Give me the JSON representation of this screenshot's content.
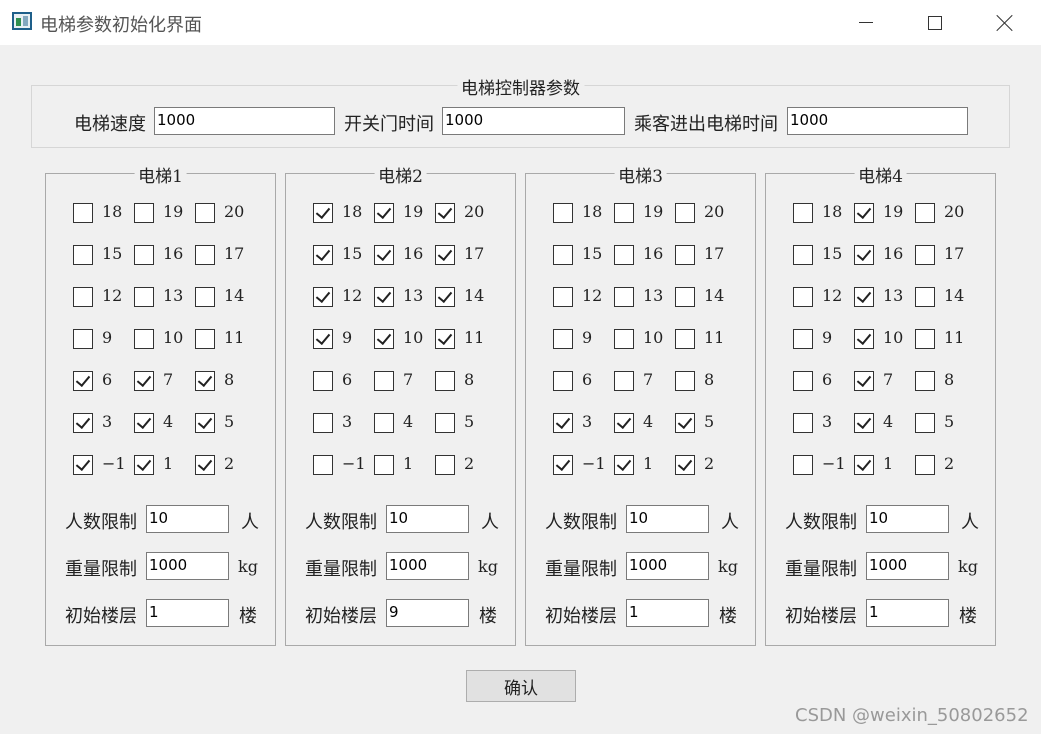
{
  "window": {
    "title": "电梯参数初始化界面"
  },
  "controller": {
    "title": "电梯控制器参数",
    "speed_label": "电梯速度",
    "speed_value": "1000",
    "door_time_label": "开关门时间",
    "door_time_value": "1000",
    "passenger_time_label": "乘客进出电梯时间",
    "passenger_time_value": "1000"
  },
  "floor_rows": [
    [
      "18",
      "19",
      "20"
    ],
    [
      "15",
      "16",
      "17"
    ],
    [
      "12",
      "13",
      "14"
    ],
    [
      "9",
      "10",
      "11"
    ],
    [
      "6",
      "7",
      "8"
    ],
    [
      "3",
      "4",
      "5"
    ],
    [
      "−1",
      "1",
      "2"
    ]
  ],
  "labels": {
    "people_limit": "人数限制",
    "people_unit": "人",
    "weight_limit": "重量限制",
    "weight_unit": "kg",
    "initial_floor": "初始楼层",
    "floor_unit": "楼"
  },
  "elevators": [
    {
      "title": "电梯1",
      "checked": [
        [
          false,
          false,
          false
        ],
        [
          false,
          false,
          false
        ],
        [
          false,
          false,
          false
        ],
        [
          false,
          false,
          false
        ],
        [
          true,
          true,
          true
        ],
        [
          true,
          true,
          true
        ],
        [
          true,
          true,
          true
        ]
      ],
      "people_limit": "10",
      "weight_limit": "1000",
      "initial_floor": "1"
    },
    {
      "title": "电梯2",
      "checked": [
        [
          true,
          true,
          true
        ],
        [
          true,
          true,
          true
        ],
        [
          true,
          true,
          true
        ],
        [
          true,
          true,
          true
        ],
        [
          false,
          false,
          false
        ],
        [
          false,
          false,
          false
        ],
        [
          false,
          false,
          false
        ]
      ],
      "people_limit": "10",
      "weight_limit": "1000",
      "initial_floor": "9"
    },
    {
      "title": "电梯3",
      "checked": [
        [
          false,
          false,
          false
        ],
        [
          false,
          false,
          false
        ],
        [
          false,
          false,
          false
        ],
        [
          false,
          false,
          false
        ],
        [
          false,
          false,
          false
        ],
        [
          true,
          true,
          true
        ],
        [
          true,
          true,
          true
        ]
      ],
      "people_limit": "10",
      "weight_limit": "1000",
      "initial_floor": "1"
    },
    {
      "title": "电梯4",
      "checked": [
        [
          false,
          true,
          false
        ],
        [
          false,
          true,
          false
        ],
        [
          false,
          true,
          false
        ],
        [
          false,
          true,
          false
        ],
        [
          false,
          true,
          false
        ],
        [
          false,
          true,
          false
        ],
        [
          false,
          true,
          false
        ]
      ],
      "people_limit": "10",
      "weight_limit": "1000",
      "initial_floor": "1"
    }
  ],
  "confirm_label": "确认",
  "watermark": "CSDN @weixin_50802652"
}
